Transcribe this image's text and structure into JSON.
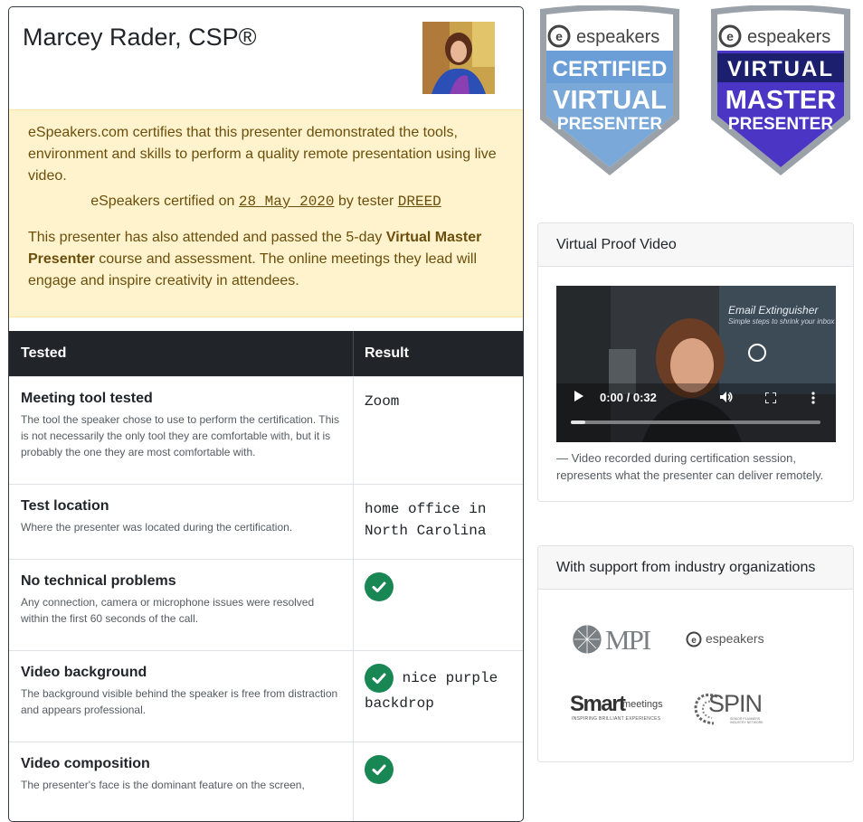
{
  "presenter": {
    "name": "Marcey Rader, CSP®"
  },
  "certification": {
    "paragraph1": "eSpeakers.com certifies that this presenter demonstrated the tools, environment and skills to perform a quality remote presentation using live video.",
    "certified_on_label": "eSpeakers certified on",
    "date": "28 May 2020",
    "by_tester_label": "by tester",
    "tester": "DREED",
    "paragraph2_pre": "This presenter has also attended and passed the 5-day",
    "paragraph2_bold": "Virtual Master Presenter",
    "paragraph2_post": "course and assessment. The online meetings they lead will engage and inspire creativity in attendees."
  },
  "table": {
    "headers": {
      "tested": "Tested",
      "result": "Result"
    },
    "rows": [
      {
        "title": "Meeting tool tested",
        "description": "The tool the speaker chose to use to perform the certification. This is not necessarily the only tool they are comfortable with, but it is probably the one they are most comfortable with.",
        "result": "Zoom",
        "check": false
      },
      {
        "title": "Test location",
        "description": "Where the presenter was located during the certification.",
        "result": "home office in North Carolina",
        "check": false
      },
      {
        "title": "No technical problems",
        "description": "Any connection, camera or microphone issues were resolved within the first 60 seconds of the call.",
        "result": "",
        "check": true
      },
      {
        "title": "Video background",
        "description": "The background visible behind the speaker is free from distraction and appears professional.",
        "result": "nice purple backdrop",
        "check": true
      },
      {
        "title": "Video composition",
        "description": "The presenter's face is the dominant feature on the screen,",
        "result": "",
        "check": true
      }
    ]
  },
  "badges": {
    "certified": {
      "brand": "espeakers",
      "line1": "CERTIFIED",
      "line2": "VIRTUAL",
      "line3": "PRESENTER"
    },
    "master": {
      "brand": "espeakers",
      "line1": "VIRTUAL",
      "line2": "MASTER",
      "line3": "PRESENTER"
    }
  },
  "video_panel": {
    "title": "Virtual Proof Video",
    "time": "0:00 / 0:32",
    "overlay_title": "Email Extinguisher",
    "overlay_subtitle": "Simple steps to shrink your inbox",
    "caption": "— Video recorded during certification session, represents what the presenter can deliver remotely."
  },
  "support_panel": {
    "title": "With support from industry organizations",
    "logos": {
      "mpi": "MPI",
      "espeakers": "espeakers",
      "smart": "Smart",
      "smart_suffix": "meetings",
      "smart_tagline": "INSPIRING BRILLIANT EXPERIENCES",
      "spin": "SPIN",
      "spin_tagline": "SENIOR PLANNERS INDUSTRY NETWORK"
    }
  },
  "colors": {
    "cert_bg": "#fff3cd",
    "header_dark": "#212529",
    "check_green": "#198754",
    "badge_light_blue": "#6fa0d6",
    "badge_purple": "#4b35c4"
  }
}
